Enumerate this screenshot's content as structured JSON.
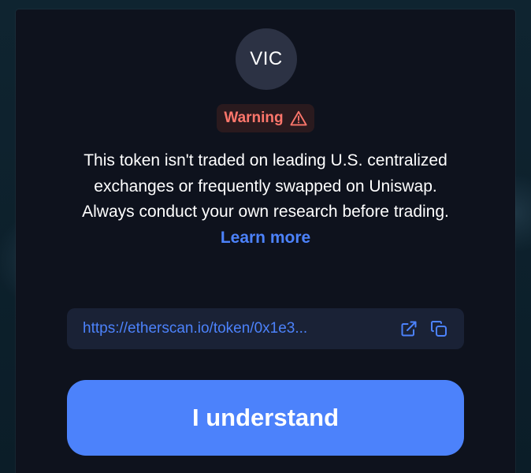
{
  "token": {
    "symbol": "VIC"
  },
  "warning": {
    "label": "Warning",
    "icon": "alert-triangle-icon",
    "color": "#fd766b"
  },
  "message": {
    "body": "This token isn't traded on leading U.S. centralized exchanges or frequently swapped on Uniswap. Always conduct your own research before trading.",
    "learn_more": "Learn more"
  },
  "explorer_link": {
    "url": "https://etherscan.io/token/0x1e3...",
    "open_icon": "external-link-icon",
    "copy_icon": "copy-icon"
  },
  "actions": {
    "confirm_label": "I understand"
  },
  "colors": {
    "accent": "#4c82fb",
    "modal_background": "#0e121d",
    "warning_text": "#fd766b"
  }
}
